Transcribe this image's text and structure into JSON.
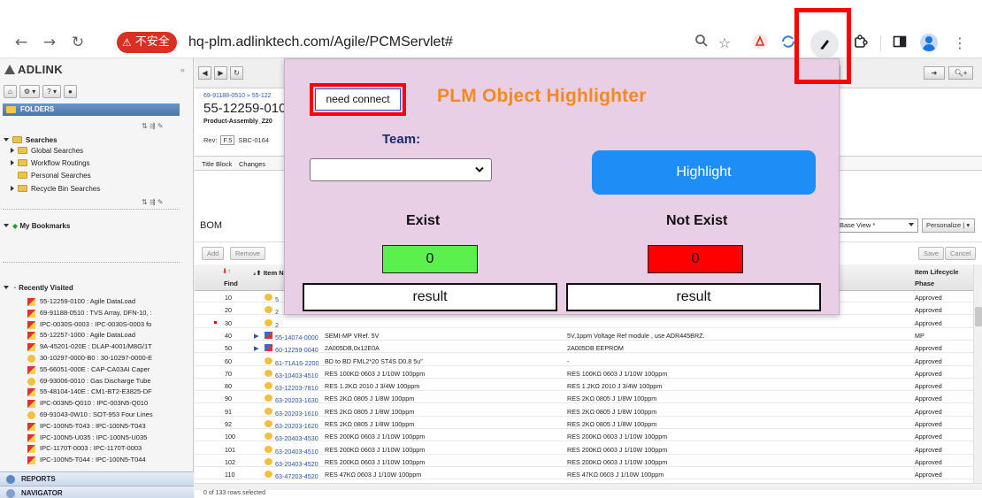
{
  "browser": {
    "security_label": "不安全",
    "url": "hq-plm.adlinktech.com/Agile/PCMServlet#",
    "icons": [
      "back-icon",
      "forward-icon",
      "reload-icon",
      "zoom-icon",
      "star-icon",
      "acrobat-icon",
      "sync-icon",
      "pen-extension-icon",
      "puzzle-icon",
      "sidepanel-icon",
      "profile-icon",
      "menu-icon"
    ]
  },
  "sidebar": {
    "logo": "ADLINK",
    "folders_label": "FOLDERS",
    "searches_label": "Searches",
    "search_items": [
      "Global Searches",
      "Workflow Routings",
      "Personal Searches",
      "Recycle Bin Searches"
    ],
    "bookmarks_label": "My Bookmarks",
    "recent_label": "Recently Visited",
    "recent_items": [
      {
        "text": "55-12259-0100 : Agile DataLoad",
        "icon": "red"
      },
      {
        "text": "69-91188-0510 : TVS Array, DFN-10, :",
        "icon": "red"
      },
      {
        "text": "IPC-0030S-0003 : IPC-0030S-0003 fo",
        "icon": "red"
      },
      {
        "text": "55-12257-1000 : Agile DataLoad",
        "icon": "red"
      },
      {
        "text": "9A-45201-020E : DLAP-4001/M8G/1T",
        "icon": "red"
      },
      {
        "text": "30-10297-0000-B0 : 30-10297-0000-E",
        "icon": "gold"
      },
      {
        "text": "55-66051-000E : CAP-CA03AI Caper",
        "icon": "red"
      },
      {
        "text": "69-93006-0010 : Gas Discharge Tube",
        "icon": "gold"
      },
      {
        "text": "55-48104-140E : CM1-BT2-E3825-DF",
        "icon": "red"
      },
      {
        "text": "IPC-003N5-Q010 : IPC-003N5-Q010",
        "icon": "red"
      },
      {
        "text": "69-91043-0W10 : SOT-953 Four Lines",
        "icon": "gold"
      },
      {
        "text": "IPC-100N5-T043 : IPC-100N5-T043",
        "icon": "red"
      },
      {
        "text": "IPC-100N5-U035 : IPC-100N5-U035",
        "icon": "red"
      },
      {
        "text": "IPC-1170T-0003 : IPC-1170T-0003",
        "icon": "red"
      },
      {
        "text": "IPC-100N5-T044 : IPC-100N5-T044",
        "icon": "red"
      }
    ],
    "reports_label": "REPORTS",
    "navigator_label": "NAVIGATOR"
  },
  "main": {
    "breadcrumb": "69-91188-0510 » 55-122",
    "title": "55-12259-010",
    "subtitle": "Product-Assembly_Z20",
    "rev_label": "Rev:",
    "rev_value": "F.5",
    "rev_extra": "SBC-0164",
    "tabs": [
      "Title Block",
      "Changes"
    ],
    "bom_label": "BOM",
    "bom_view": "Base View *",
    "personalize": "Personalize",
    "actions": [
      "Add",
      "Remove"
    ],
    "actions_right": [
      "Save",
      "Cancel"
    ],
    "columns": {
      "find": "Find",
      "item": "Item N",
      "lifecycle_1": "Item Lifecycle",
      "lifecycle_2": "Phase"
    },
    "rows": [
      {
        "find": "10",
        "pn": "5",
        "d1": "",
        "d2": "",
        "lc": "Approved",
        "type": "part"
      },
      {
        "find": "20",
        "pn": "2",
        "d1": "",
        "d2": "",
        "lc": "Approved",
        "type": "part"
      },
      {
        "find": "30",
        "pn": "2",
        "d1": "",
        "d2": "",
        "lc": "Approved",
        "type": "part",
        "marker": true
      },
      {
        "find": "40",
        "pn": "55-14074-0000",
        "d1": "SEMI-MP VRef. 5V",
        "d2": "5V,1ppm Voltage Ref module , use ADR445BRZ.",
        "lc": "MP",
        "type": "asm"
      },
      {
        "find": "50",
        "pn": "60-12259-0040",
        "d1": "2A005DB,0x12E0A",
        "d2": "2A005DB EEPROM",
        "lc": "Approved",
        "type": "asm"
      },
      {
        "find": "60",
        "pn": "61-71A16-2200",
        "d1": "BD to BD FML2*20 ST4S D0.8 5u\"",
        "d2": "-",
        "lc": "Approved",
        "type": "part"
      },
      {
        "find": "70",
        "pn": "63-10403-4510",
        "d1": "RES 100KΩ 0603 J 1/10W 100ppm",
        "d2": "RES 100KΩ 0603 J 1/10W 100ppm",
        "lc": "Approved",
        "type": "part"
      },
      {
        "find": "80",
        "pn": "63-12203-7810",
        "d1": "RES 1.2KΩ 2010 J 3/4W 100ppm",
        "d2": "RES 1.2KΩ 2010 J 3/4W 100ppm",
        "lc": "Approved",
        "type": "part"
      },
      {
        "find": "90",
        "pn": "63-20203-1630",
        "d1": "RES 2KΩ 0805 J 1/8W 100ppm",
        "d2": "RES 2KΩ 0805 J 1/8W 100ppm",
        "lc": "Approved",
        "type": "part"
      },
      {
        "find": "91",
        "pn": "63-20203-1610",
        "d1": "RES 2KΩ 0805 J 1/8W 100ppm",
        "d2": "RES 2KΩ 0805 J 1/8W 100ppm",
        "lc": "Approved",
        "type": "part"
      },
      {
        "find": "92",
        "pn": "63-20203-1620",
        "d1": "RES 2KΩ 0805 J 1/8W 100ppm",
        "d2": "RES 2KΩ 0805 J 1/8W 100ppm",
        "lc": "Approved",
        "type": "part"
      },
      {
        "find": "100",
        "pn": "63-20403-4530",
        "d1": "RES 200KΩ 0603 J 1/10W 100ppm",
        "d2": "RES 200KΩ 0603 J 1/10W 100ppm",
        "lc": "Approved",
        "type": "part"
      },
      {
        "find": "101",
        "pn": "63-20403-4510",
        "d1": "RES 200KΩ 0603 J 1/10W 100ppm",
        "d2": "RES 200KΩ 0603 J 1/10W 100ppm",
        "lc": "Approved",
        "type": "part"
      },
      {
        "find": "102",
        "pn": "63-20403-4520",
        "d1": "RES 200KΩ 0603 J 1/10W 100ppm",
        "d2": "RES 200KΩ 0603 J 1/10W 100ppm",
        "lc": "Approved",
        "type": "part"
      },
      {
        "find": "110",
        "pn": "63-47203-4520",
        "d1": "RES 47KΩ 0603 J 1/10W 100ppm",
        "d2": "RES 47KΩ 0603 J 1/10W 100ppm",
        "lc": "Approved",
        "type": "part"
      }
    ],
    "status": "0 of 133 rows selected"
  },
  "popup": {
    "connect_label": "need connect",
    "title": "PLM Object Highlighter",
    "team_label": "Team:",
    "team_value": "",
    "highlight_label": "Highlight",
    "exist_label": "Exist",
    "not_exist_label": "Not Exist",
    "exist_count": "0",
    "not_exist_count": "0",
    "result_left": "result",
    "result_right": "result"
  },
  "colors": {
    "popup_bg": "#e8cfe6",
    "title_orange": "#f08a24",
    "highlight_blue": "#1e8df5",
    "exist_green": "#5cf04f",
    "not_exist_red": "#ff0000",
    "annotation_red": "#ff0000",
    "security_red": "#d93025"
  }
}
